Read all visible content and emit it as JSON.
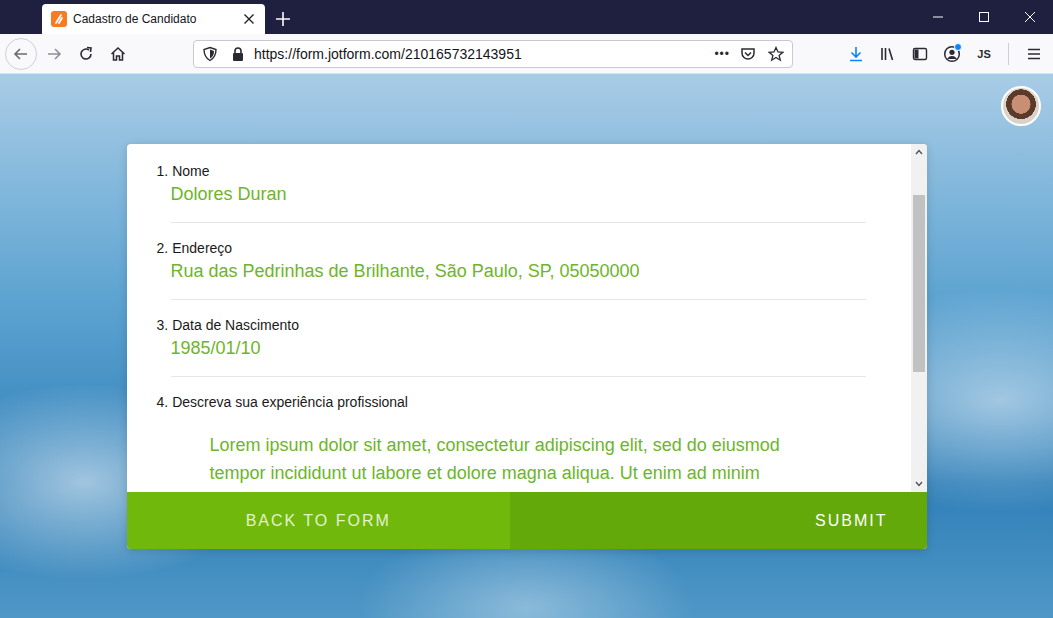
{
  "tabs": [
    {
      "label": "Cadastro de Candidato",
      "selected": true
    }
  ],
  "address_bar": {
    "url": "https://form.jotform.com/210165732143951",
    "menu": "•••"
  },
  "toolbar": {
    "downloads_active": true,
    "account_notification": true,
    "account_initials": "JS"
  },
  "form": {
    "fields": [
      {
        "number": "1.",
        "label": "Nome",
        "value": "Dolores Duran",
        "kind": "short"
      },
      {
        "number": "2.",
        "label": "Endereço",
        "value": "Rua das Pedrinhas de Brilhante, São Paulo, SP, 05050000",
        "kind": "short"
      },
      {
        "number": "3.",
        "label": "Data de Nascimento",
        "value": "1985/01/10",
        "kind": "short"
      },
      {
        "number": "4.",
        "label": "Descreva sua experiência profissional",
        "value": "Lorem ipsum dolor sit amet, consectetur adipiscing elit, sed do eiusmod tempor incididunt ut labore et dolore magna aliqua. Ut enim ad minim",
        "kind": "long"
      }
    ],
    "scrollbar": {
      "level": 0.56
    },
    "buttons": [
      {
        "label": "BACK TO FORM",
        "kind": "secondary"
      },
      {
        "label": "SUBMIT",
        "kind": "primary"
      }
    ]
  }
}
